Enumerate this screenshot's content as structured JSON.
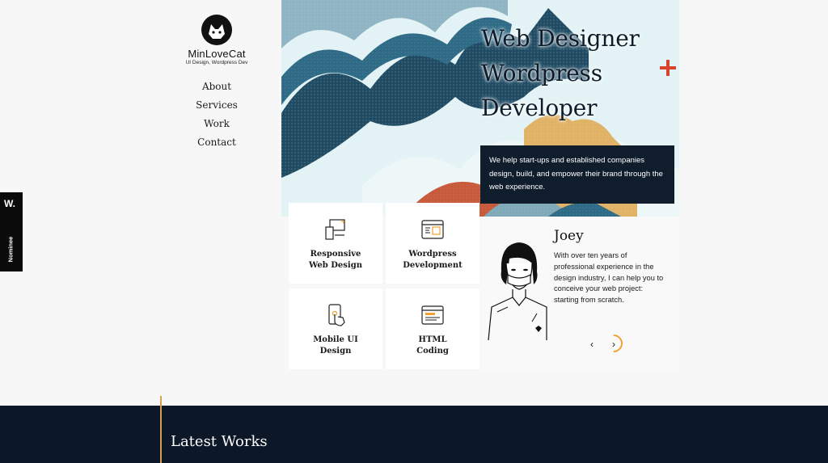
{
  "brand": {
    "name": "MinLoveCat",
    "tagline": "UI Design, Wordpress Dev"
  },
  "nav": [
    "About",
    "Services",
    "Work",
    "Contact"
  ],
  "badge": {
    "mark": "W.",
    "label": "Nominee"
  },
  "hero": {
    "title_lines": [
      "Web Designer",
      "Wordpress",
      "Developer"
    ],
    "description": "We help start-ups and established companies design, build, and empower their brand through the web experience."
  },
  "services": [
    {
      "label_line1": "Responsive",
      "label_line2": "Web Design",
      "icon": "responsive-devices-icon"
    },
    {
      "label_line1": "Wordpress",
      "label_line2": "Development",
      "icon": "browser-code-icon"
    },
    {
      "label_line1": "Mobile UI",
      "label_line2": "Design",
      "icon": "mobile-tap-icon"
    },
    {
      "label_line1": "HTML",
      "label_line2": "Coding",
      "icon": "html-window-icon"
    }
  ],
  "profile": {
    "name": "Joey",
    "bio": "With over ten years of professional experience in the design industry, I can help you to conceive your web project: starting from scratch."
  },
  "slider": {
    "prev": "‹",
    "next": "›"
  },
  "footer": {
    "section_title": "Latest Works"
  },
  "colors": {
    "navy": "#0f1d2d",
    "accent_red": "#d9432b",
    "accent_gold": "#d4a24c",
    "accent_orange": "#f0a030"
  }
}
